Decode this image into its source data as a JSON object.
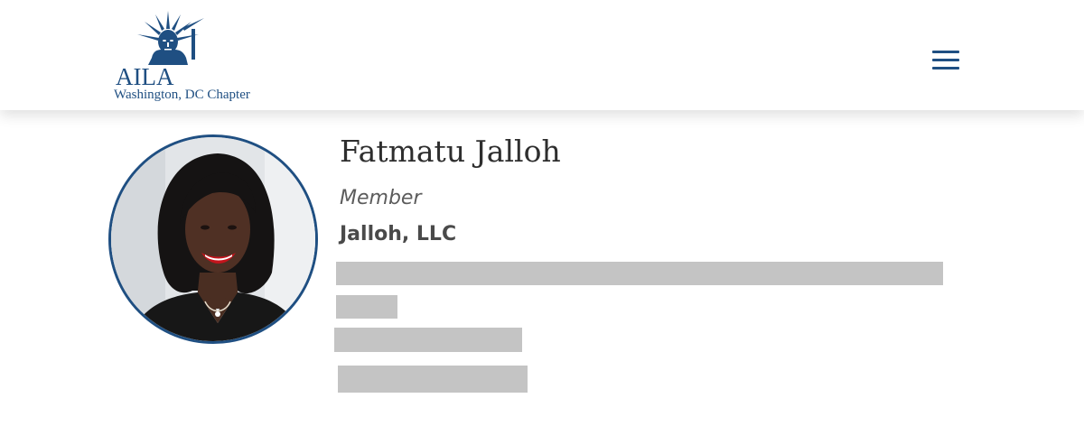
{
  "header": {
    "logo": {
      "wordmark": "AILA",
      "subtitle": "Washington, DC Chapter",
      "icon": "statue-of-liberty-icon"
    },
    "menu_icon": "hamburger-menu-icon"
  },
  "profile": {
    "name": "Fatmatu Jalloh",
    "role": "Member",
    "company": "Jalloh, LLC",
    "redacted_lines": 4
  },
  "colors": {
    "brand": "#1f4f82",
    "redaction": "#c4c4c4",
    "text": "#2e2e2e"
  }
}
